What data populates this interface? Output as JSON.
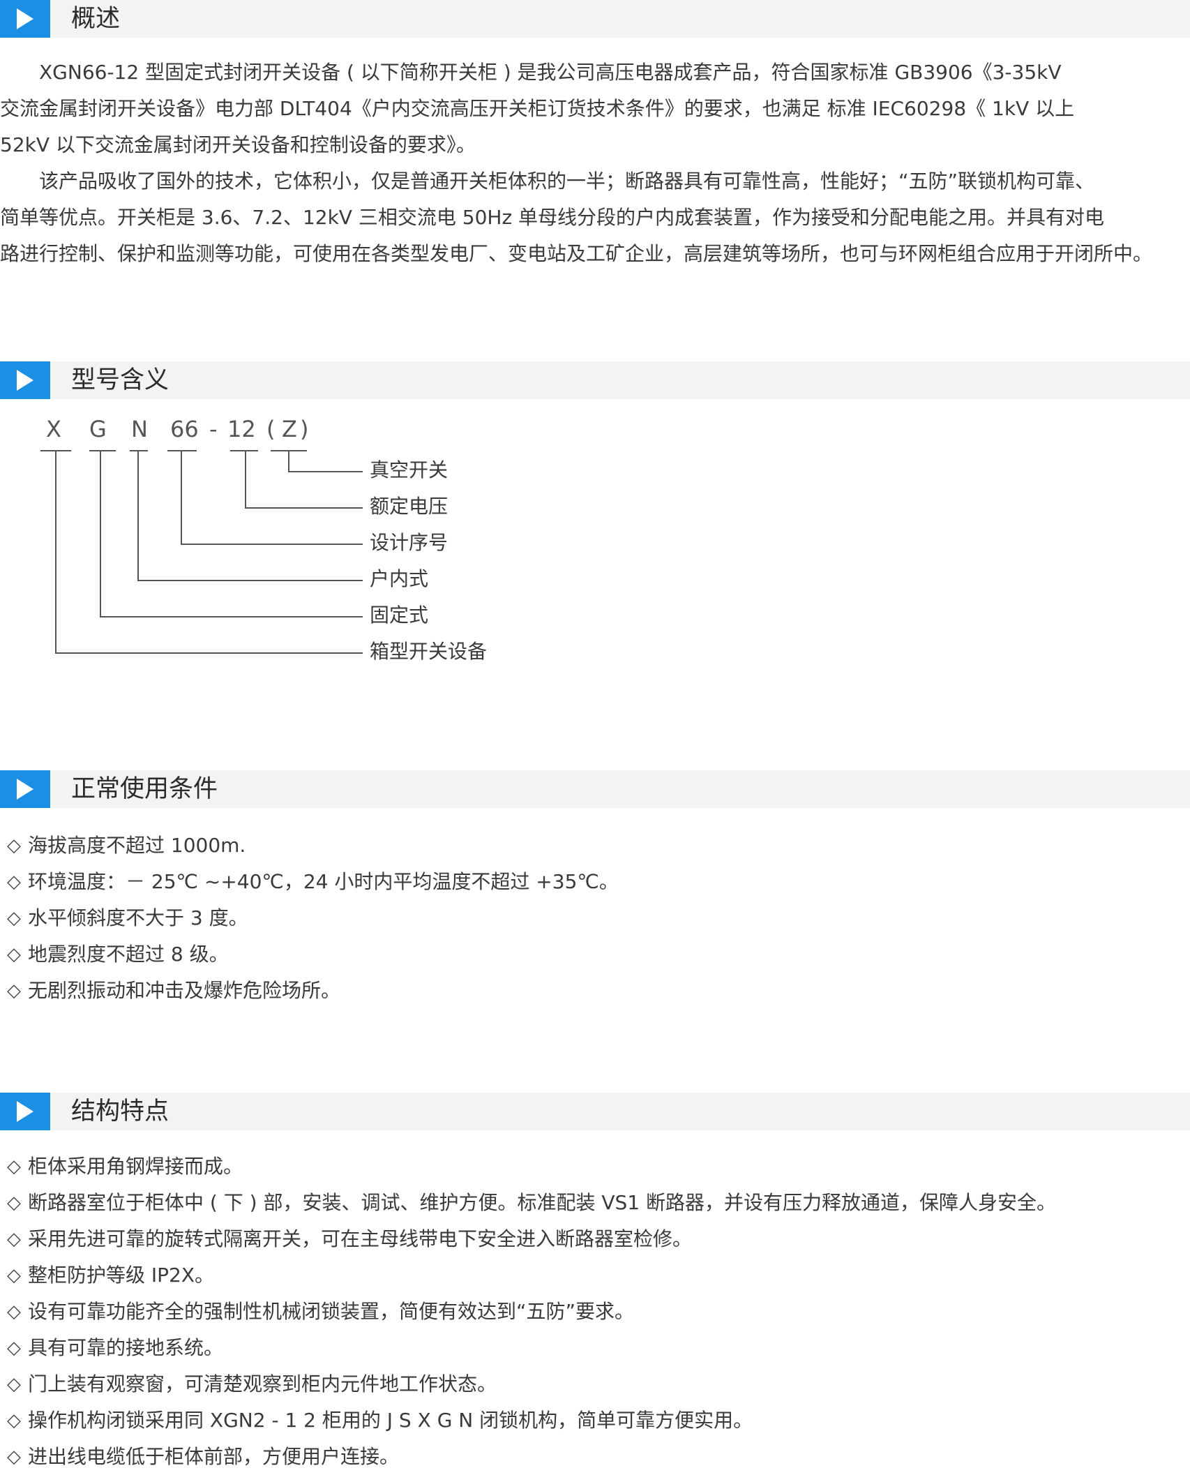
{
  "sections": {
    "overview": {
      "title": "概述",
      "lines": [
        "　　XGN66-12 型固定式封闭开关设备 ( 以下简称开关柜 ) 是我公司高压电器成套产品，符合国家标准 GB3906《3-35kV",
        "交流金属封闭开关设备》电力部 DLT404《户内交流高压开关柜订货技术条件》的要求，也满足 标准 IEC60298《 1kV 以上",
        "52kV 以下交流金属封闭开关设备和控制设备的要求》。",
        "　　该产品吸收了国外的技术，它体积小，仅是普通开关柜体积的一半；断路器具有可靠性高，性能好；“五防”联锁机构可靠、",
        "简单等优点。开关柜是 3.6、7.2、12kV 三相交流电 50Hz 单母线分段的户内成套装置，作为接受和分配电能之用。并具有对电",
        "路进行控制、保护和监测等功能，可使用在各类型发电厂、变电站及工矿企业，高层建筑等场所，也可与环网柜组合应用于开闭所中。"
      ]
    },
    "model": {
      "title": "型号含义",
      "code": [
        "X",
        "G",
        "N",
        "66",
        "-",
        "12",
        "(",
        "Z",
        ")"
      ],
      "labels": [
        "真空开关",
        "额定电压",
        "设计序号",
        "户内式",
        "固定式",
        "箱型开关设备"
      ]
    },
    "conditions": {
      "title": "正常使用条件",
      "bullet": "◇",
      "items": [
        "海拔高度不超过 1000m.",
        "环境温度：－ 25℃ ~+40℃，24 小时内平均温度不超过 +35℃。",
        "水平倾斜度不大于 3 度。",
        "地震烈度不超过 8 级。",
        "无剧烈振动和冲击及爆炸危险场所。"
      ]
    },
    "features": {
      "title": "结构特点",
      "bullet": "◇",
      "items": [
        "柜体采用角钢焊接而成。",
        "断路器室位于柜体中 ( 下 ) 部，安装、调试、维护方便。标准配装 VS1 断路器，并设有压力释放通道，保障人身安全。",
        "采用先进可靠的旋转式隔离开关，可在主母线带电下安全进入断路器室检修。",
        "整柜防护等级 IP2X。",
        "设有可靠功能齐全的强制性机械闭锁装置，简便有效达到“五防”要求。",
        "具有可靠的接地系统。",
        "门上装有观察窗，可清楚观察到柜内元件地工作状态。",
        "操作机构闭锁采用同 XGN2 - 1 2 柜用的 J S X G N 闭锁机构，简单可靠方便实用。",
        "进出线电缆低于柜体前部，方便用户连接。"
      ]
    }
  }
}
